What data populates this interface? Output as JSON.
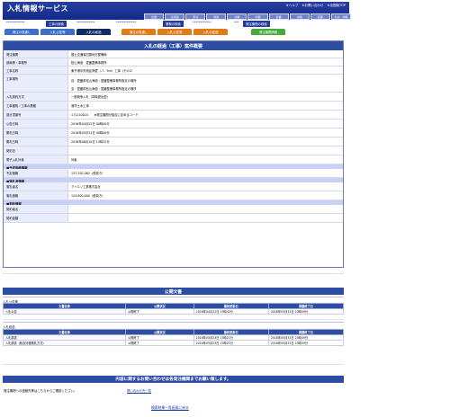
{
  "header": {
    "title": "入札情報サービス",
    "top_links": [
      "★ヘルプ",
      "★お問い合わせ",
      "★全国版TOP"
    ],
    "regions": [
      "全国",
      "北海道",
      "東北",
      "関東",
      "北陸",
      "中部",
      "近畿",
      "中国",
      "四国",
      "九州・沖縄"
    ]
  },
  "search": {
    "titles": [
      "工事の検索",
      "業務の検索",
      "発注機関の検索"
    ],
    "stars": [
      "************",
      "************",
      "*************",
      "************",
      "***"
    ],
    "tabs": [
      "発注の見通し",
      "入札公告等",
      "入札の経過",
      "発注の見通し",
      "入札公告等",
      "入札の経過",
      "発注機関情報"
    ]
  },
  "details": {
    "title": "入札の経過（工事）案件概要",
    "rows": [
      {
        "label": "発注機関",
        "value": "国土交通省四国地方整備局"
      },
      {
        "label": "部局等・事務所",
        "value": "松山海道　愛媛整備事務所"
      },
      {
        "label": "工事名称",
        "value": "東予港中央地区岸壁（-7．5ｍ）工事（その2）"
      },
      {
        "label": "工事場所",
        "value": "自：愛媛県松山海道・愛媛整備事務所指定の場所",
        "value2": "至：愛媛県松山海道・愛媛整備事務所指定の場所"
      },
      {
        "label": "入札契約方式",
        "value": "一般競争入札（同時提出型）"
      },
      {
        "label": "工事種別／工事の業種",
        "value": "港湾土木工事"
      },
      {
        "label": "設計書番号",
        "value": "171110024　　★発注機関が独自に定めるコード"
      },
      {
        "label": "公告日時",
        "value": "2016年04月22日 00時00分"
      },
      {
        "label": "開札日時",
        "value": "2016年05月31日 00時00分"
      },
      {
        "label": "開札日時",
        "value": "2016年06月10日 13時32分"
      },
      {
        "label": "契約日",
        "value": ""
      },
      {
        "label": "電子入札対象",
        "value": "対象"
      },
      {
        "section": "■予定価格情報"
      },
      {
        "label": "予定価格",
        "value": "137,592,062（税抜き）"
      },
      {
        "section": "■落札者情報"
      },
      {
        "label": "落札者名",
        "value": "アイエン工業株式会社"
      },
      {
        "label": "落札価格",
        "value": "124,800,000（税抜き）"
      },
      {
        "section": "■契約情報"
      },
      {
        "label": "契約者名",
        "value": ""
      },
      {
        "label": "契約金額",
        "value": ""
      }
    ]
  },
  "documents": {
    "title": "公開文書",
    "tables": [
      {
        "section": "入札公告等",
        "headers": [
          "文書名称",
          "公開状況",
          "最終更新日",
          "掲載終了日"
        ],
        "rows": [
          [
            "入札公告",
            "公開終了",
            "2016年04月22日 13時42分",
            "2016年05月31日 23時59分"
          ]
        ]
      },
      {
        "section": "入札経過",
        "headers": [
          "文書名称",
          "公開状況",
          "最終更新日",
          "掲載終了日"
        ],
        "rows": [
          [
            "入札調書",
            "公開終了",
            "2016年05月23日 13時21分",
            "2016年05月31日 23時59分"
          ],
          [
            "入札調書（総合評価落札方式）",
            "公開終了",
            "2016年05月23日 13時21分",
            "2016年05月31日 23時59分"
          ]
        ]
      }
    ]
  },
  "contact": {
    "title": "内容に関するお問い合わせは各発注機関までお願い致します。",
    "text": "発注機関への連絡先等はこちらからご確認ください。",
    "link": "問い合わせ先一覧",
    "back": "検索結果一覧画面に戻る"
  }
}
